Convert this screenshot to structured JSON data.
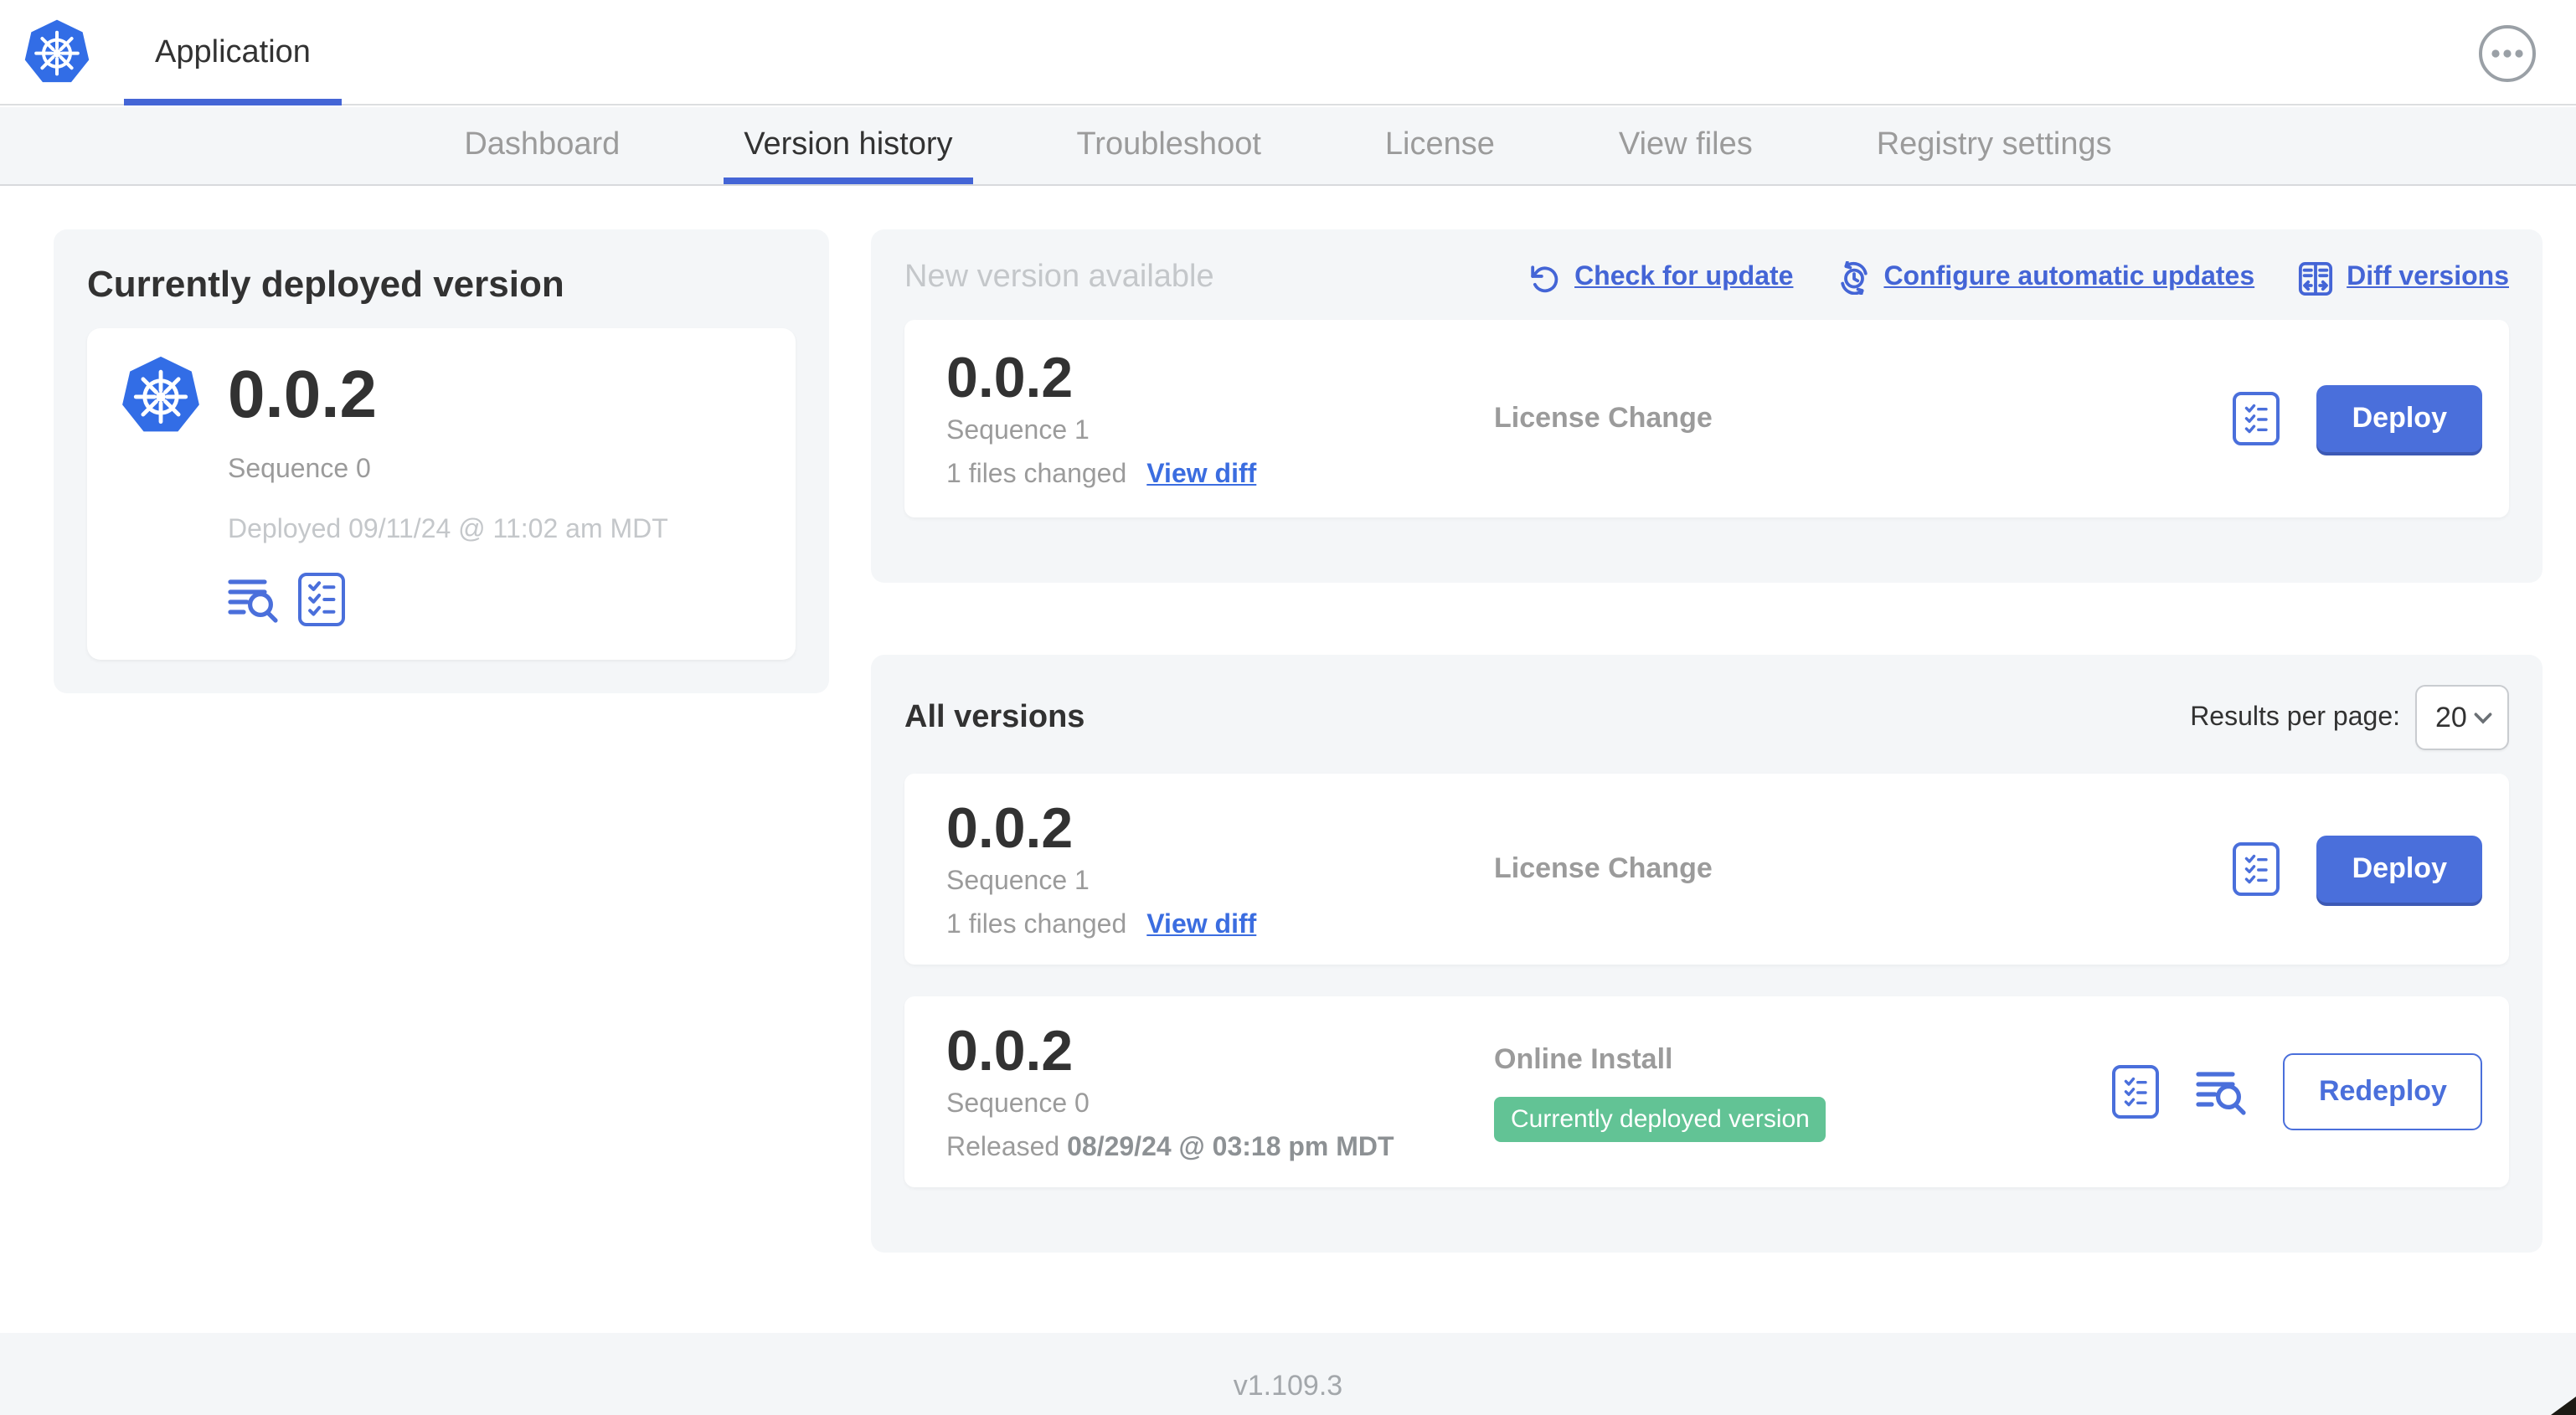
{
  "header": {
    "app_title": "Application"
  },
  "nav": {
    "tabs": [
      {
        "label": "Dashboard",
        "active": false
      },
      {
        "label": "Version history",
        "active": true
      },
      {
        "label": "Troubleshoot",
        "active": false
      },
      {
        "label": "License",
        "active": false
      },
      {
        "label": "View files",
        "active": false
      },
      {
        "label": "Registry settings",
        "active": false
      }
    ]
  },
  "deployed_panel": {
    "heading": "Currently deployed version",
    "version": "0.0.2",
    "sequence": "Sequence 0",
    "deployed_at": "Deployed 09/11/24 @ 11:02 am MDT"
  },
  "new_version_panel": {
    "heading": "New version available",
    "check_for_update": "Check for update",
    "configure_updates": "Configure automatic updates",
    "diff_versions": "Diff versions",
    "card": {
      "version": "0.0.2",
      "sequence": "Sequence 1",
      "files_changed": "1 files changed",
      "view_diff": "View diff",
      "source": "License Change",
      "deploy": "Deploy"
    }
  },
  "all_versions_panel": {
    "heading": "All versions",
    "results_label": "Results per page:",
    "results_value": "20",
    "rows": [
      {
        "version": "0.0.2",
        "sequence": "Sequence 1",
        "files_changed": "1 files changed",
        "view_diff": "View diff",
        "source": "License Change",
        "action": "Deploy"
      },
      {
        "version": "0.0.2",
        "sequence": "Sequence 0",
        "released_prefix": "Released ",
        "released_date": "08/29/24 @ 03:18 pm MDT",
        "source": "Online Install",
        "badge": "Currently deployed version",
        "action": "Redeploy"
      }
    ]
  },
  "footer": {
    "app_version": "v1.109.3"
  },
  "colors": {
    "accent": "#4a6fdb",
    "link": "#4465d6",
    "green": "#62c395",
    "kubernetes_blue": "#326de6"
  }
}
